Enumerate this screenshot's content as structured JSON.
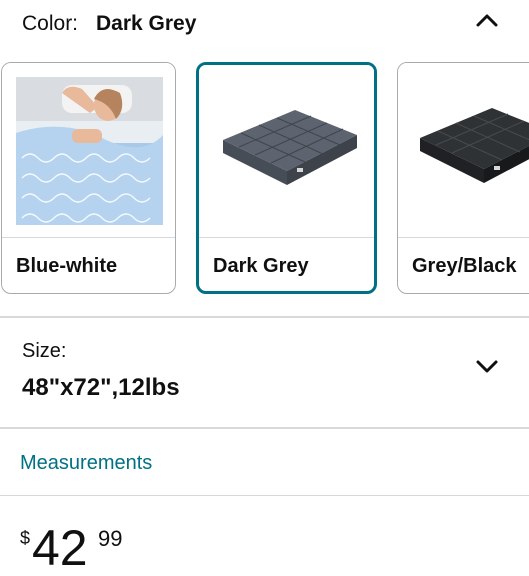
{
  "color": {
    "label": "Color:",
    "selected": "Dark Grey",
    "options": [
      {
        "label": "Blue-white",
        "image": "blanket-woman-photo"
      },
      {
        "label": "Dark Grey",
        "image": "dark-grey-blanket"
      },
      {
        "label": "Grey/Black",
        "image": "grey-black-blanket"
      }
    ],
    "selected_border": "#007185"
  },
  "size": {
    "label": "Size:",
    "selected": "48\"x72\",12lbs"
  },
  "measurements_link": "Measurements",
  "price": {
    "symbol": "$",
    "whole": "42",
    "fraction": "99"
  },
  "icons": {
    "collapse": "chevron-up-icon",
    "expand": "chevron-down-icon"
  }
}
